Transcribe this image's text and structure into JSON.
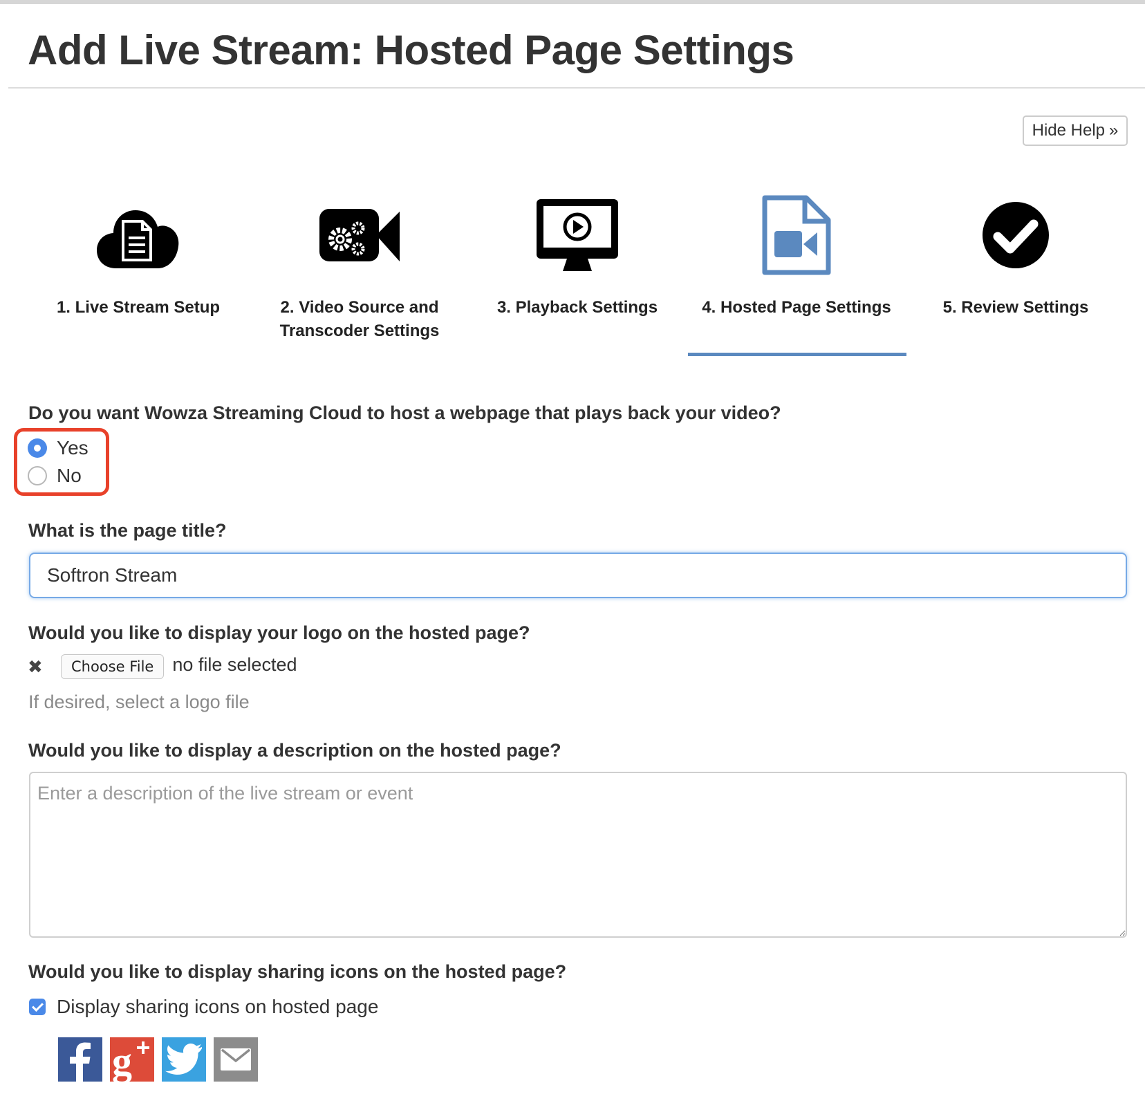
{
  "page": {
    "title": "Add Live Stream: Hosted Page Settings"
  },
  "help_button": {
    "label": "Hide Help",
    "icon": "double-chevron-right-icon"
  },
  "steps": [
    {
      "label": "1. Live Stream Setup",
      "icon": "cloud-document-icon"
    },
    {
      "label": "2. Video Source and Transcoder Settings",
      "icon": "video-camera-gears-icon"
    },
    {
      "label": "3. Playback Settings",
      "icon": "monitor-play-icon"
    },
    {
      "label": "4. Hosted Page Settings",
      "icon": "video-file-icon",
      "active": true
    },
    {
      "label": "5. Review Settings",
      "icon": "checkmark-circle-icon"
    }
  ],
  "form": {
    "host_question": "Do you want Wowza Streaming Cloud to host a webpage that plays back your video?",
    "host_options": [
      {
        "label": "Yes",
        "selected": true
      },
      {
        "label": "No",
        "selected": false
      }
    ],
    "title_question": "What is the page title?",
    "title_value": "Softron Stream",
    "logo_question": "Would you like to display your logo on the hosted page?",
    "choose_file_label": "Choose File",
    "file_status": "no file selected",
    "logo_help": "If desired, select a logo file",
    "description_question": "Would you like to display a description on the hosted page?",
    "description_placeholder": "Enter a description of the live stream or event",
    "description_value": "",
    "sharing_question": "Would you like to display sharing icons on the hosted page?",
    "sharing_checkbox_label": "Display sharing icons on hosted page",
    "sharing_checked": true,
    "sharing_icons": [
      "facebook-icon",
      "google-plus-icon",
      "twitter-icon",
      "email-icon"
    ]
  },
  "colors": {
    "accent": "#5b89bf",
    "active_icon": "#5b89bf",
    "highlight_border": "#e8412a",
    "input_focus": "#76a9e6",
    "facebook": "#3b5998",
    "google_plus": "#dd4b39",
    "twitter": "#3aa2e0",
    "email": "#8c8c8c"
  }
}
